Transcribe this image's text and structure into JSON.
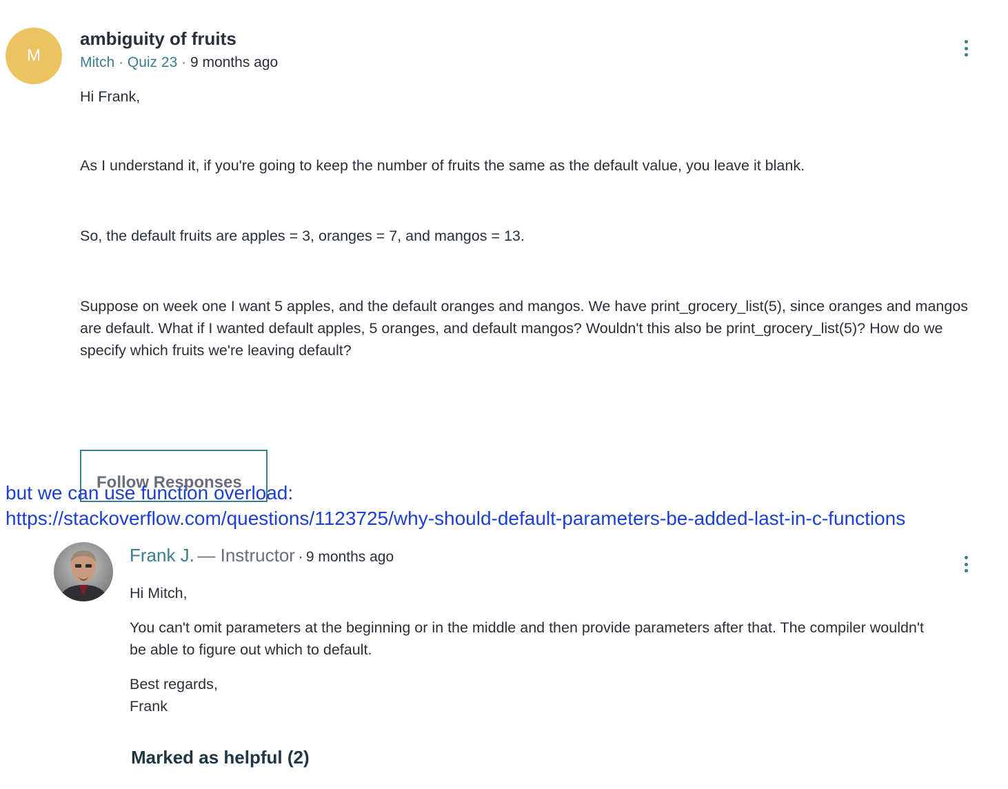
{
  "question": {
    "avatar_initial": "M",
    "title": "ambiguity of fruits",
    "author": "Mitch",
    "lecture": "Quiz 23",
    "separator": "·",
    "time": "9 months ago",
    "paragraphs": [
      "Hi Frank,",
      "As I understand it, if you're going to keep the number of fruits the same as the default value, you leave it blank.",
      "So, the default fruits are apples = 3, oranges = 7, and mangos = 13.",
      "Suppose on week one I want 5 apples, and the default oranges and mangos. We have print_grocery_list(5), since oranges and mangos are default. What if I wanted default apples, 5 oranges, and default mangos? Wouldn't this also be print_grocery_list(5)? How do we specify which fruits we're leaving default?"
    ],
    "follow_button_label": "Follow Responses"
  },
  "overlay_note": {
    "line1": "but we can use function overload:",
    "line2": "https://stackoverflow.com/questions/1123725/why-should-default-parameters-be-added-last-in-c-functions"
  },
  "reply": {
    "author": "Frank J.",
    "role": "— Instructor",
    "separator": "·",
    "time": "9 months ago",
    "paragraphs": [
      "Hi Mitch,",
      "You can't omit parameters at the beginning or in the middle and then provide parameters after that. The compiler wouldn't be able to figure out which to default."
    ],
    "signoff_line1": "Best regards,",
    "signoff_line2": "Frank",
    "helpful_label": "Marked as helpful (2)"
  },
  "colors": {
    "accent": "#3a7d8c",
    "avatar": "#ecc361",
    "annotation": "#1c3fd6",
    "text": "#29303b"
  },
  "icons": {
    "question_menu": "more-vertical-icon",
    "reply_menu": "more-vertical-icon"
  }
}
